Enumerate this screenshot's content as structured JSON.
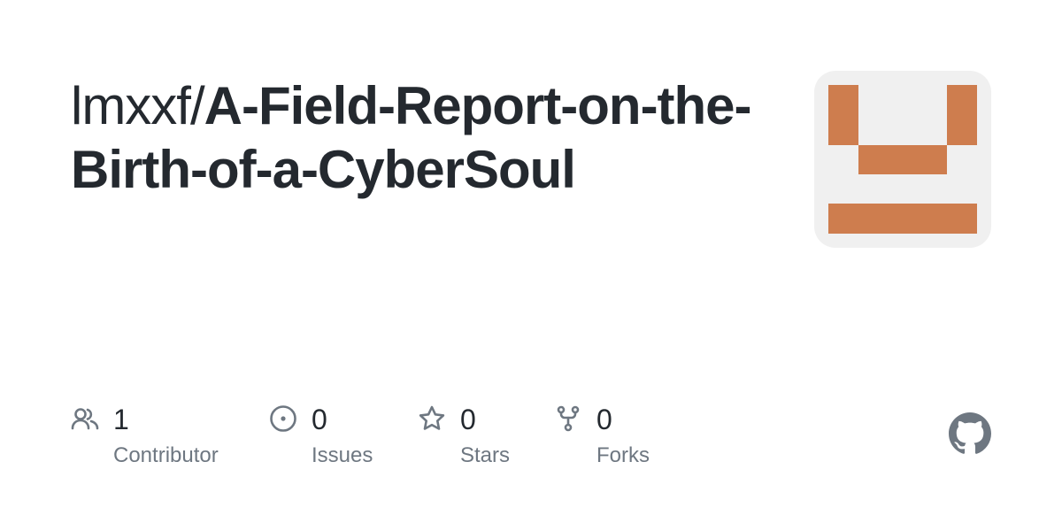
{
  "repo": {
    "owner": "lmxxf/",
    "name": "A-Field-Report-on-the-Birth-of-a-CyberSoul"
  },
  "avatar": {
    "background_color": "#f0f0f0",
    "pattern_color": "#ce7d4e"
  },
  "stats": [
    {
      "icon": "people-icon",
      "count": "1",
      "label": "Contributor"
    },
    {
      "icon": "issue-opened-icon",
      "count": "0",
      "label": "Issues"
    },
    {
      "icon": "star-icon",
      "count": "0",
      "label": "Stars"
    },
    {
      "icon": "repo-forked-icon",
      "count": "0",
      "label": "Forks"
    }
  ],
  "brand": {
    "icon": "github-mark-icon",
    "color": "#6e7781"
  }
}
